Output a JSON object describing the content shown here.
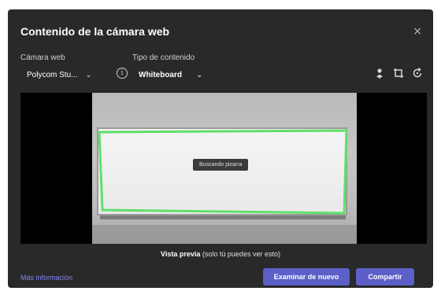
{
  "dialog": {
    "title": "Contenido de la cámara web",
    "close_symbol": "×"
  },
  "webcam": {
    "label": "Cámara web",
    "selected": "Polycom Stu..."
  },
  "content_type": {
    "label": "Tipo de contenido",
    "selected": "Whiteboard"
  },
  "icons": {
    "info": "info-icon",
    "tool1": "person-pin-icon",
    "tool2": "crop-frame-icon",
    "tool3": "rotate-icon"
  },
  "preview": {
    "status": "Buscando pizarra",
    "caption_bold": "Vista previa",
    "caption_rest": " (solo tú puedes ver esto)"
  },
  "footer": {
    "more_info": "Más información",
    "rescan_button": "Examinar de nuevo",
    "share_button": "Compartir"
  },
  "colors": {
    "dialog_bg": "#292929",
    "accent": "#5b5fc7",
    "link": "#7f85f5",
    "detect_outline": "#5ee06a"
  }
}
